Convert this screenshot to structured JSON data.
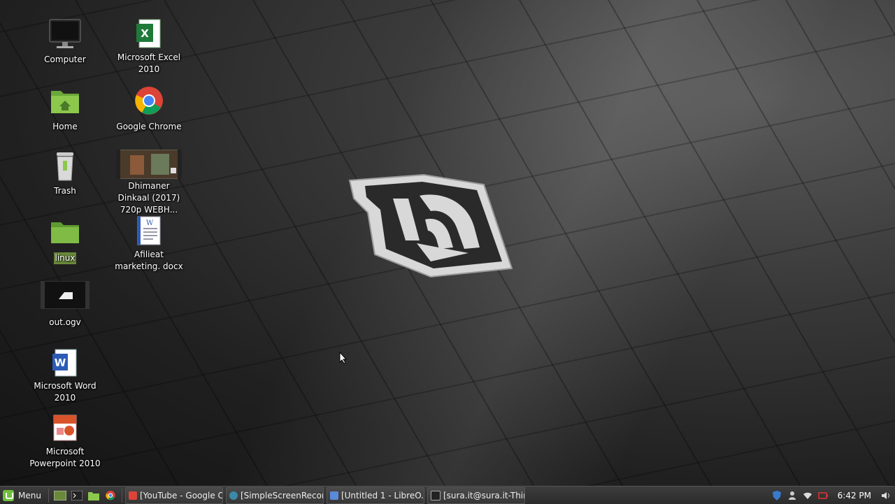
{
  "desktop": {
    "icons": [
      {
        "label": "Computer",
        "icon": "computer-icon"
      },
      {
        "label": "Home",
        "icon": "home-folder-icon"
      },
      {
        "label": "Trash",
        "icon": "trash-icon"
      },
      {
        "label": "linux",
        "icon": "folder-icon"
      },
      {
        "label": "out.ogv",
        "icon": "video-file-icon"
      },
      {
        "label": "Microsoft Word 2010",
        "icon": "word-icon"
      },
      {
        "label": "Microsoft Powerpoint 2010",
        "icon": "powerpoint-icon"
      },
      {
        "label": "Microsoft Excel 2010",
        "icon": "excel-icon"
      },
      {
        "label": "Google Chrome",
        "icon": "chrome-icon"
      },
      {
        "label": "Dhimaner Dinkaal (2017) 720p WEBH...",
        "icon": "video-thumbnail-icon"
      },
      {
        "label": "Afilieat marketing. docx",
        "icon": "docx-file-icon"
      }
    ]
  },
  "taskbar": {
    "menu_label": "Menu",
    "tasks": [
      {
        "label": "[YouTube - Google C...",
        "icon": "chrome-icon"
      },
      {
        "label": "[SimpleScreenRecor...",
        "icon": "recorder-icon"
      },
      {
        "label": "[Untitled 1 - LibreO...",
        "icon": "document-icon"
      },
      {
        "label": "[sura.it@sura.it-Thin...",
        "icon": "terminal-icon"
      }
    ],
    "clock": "6:42 PM"
  },
  "colors": {
    "accent": "#6fbf3a",
    "selection": "#6a8a3a"
  }
}
